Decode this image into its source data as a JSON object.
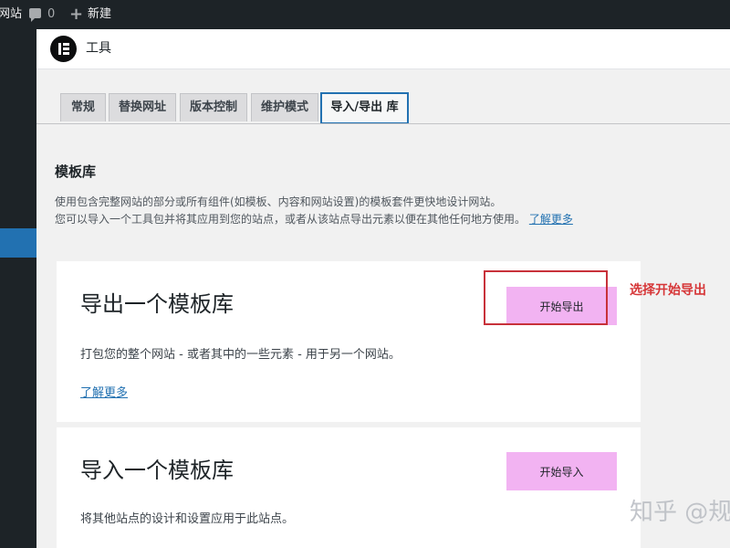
{
  "admin_bar": {
    "site_label": "网站",
    "comments_count": "0",
    "new_label": "新建"
  },
  "header": {
    "title": "工具"
  },
  "tabs": [
    {
      "label": "常规",
      "active": false
    },
    {
      "label": "替换网址",
      "active": false
    },
    {
      "label": "版本控制",
      "active": false
    },
    {
      "label": "维护模式",
      "active": false
    },
    {
      "label": "导入/导出 库",
      "active": true
    }
  ],
  "section": {
    "title": "模板库",
    "description_line1": "使用包含完整网站的部分或所有组件(如模板、内容和网站设置)的模板套件更快地设计网站。",
    "description_line2": "您可以导入一个工具包并将其应用到您的站点，或者从该站点导出元素以便在其他任何地方使用。",
    "learn_more": "了解更多"
  },
  "export_card": {
    "title": "导出一个模板库",
    "description": "打包您的整个网站 - 或者其中的一些元素 - 用于另一个网站。",
    "button": "开始导出",
    "learn_more": "了解更多"
  },
  "import_card": {
    "title": "导入一个模板库",
    "description": "将其他站点的设计和设置应用于此站点。",
    "button": "开始导入"
  },
  "annotation": {
    "text": "选择开始导出"
  },
  "watermark": "知乎 @规",
  "colors": {
    "accent": "#2271b1",
    "button": "#f2b3f2",
    "annotation": "#d63638"
  }
}
